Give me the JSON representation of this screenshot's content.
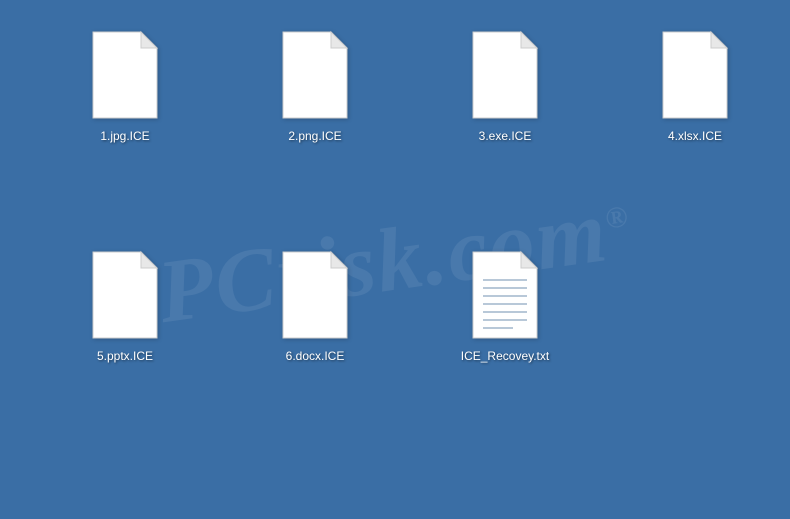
{
  "files": [
    {
      "label": "1.jpg.ICE",
      "icon": "blank"
    },
    {
      "label": "2.png.ICE",
      "icon": "blank"
    },
    {
      "label": "3.exe.ICE",
      "icon": "blank"
    },
    {
      "label": "4.xlsx.ICE",
      "icon": "blank"
    },
    {
      "label": "5.pptx.ICE",
      "icon": "blank"
    },
    {
      "label": "6.docx.ICE",
      "icon": "blank"
    },
    {
      "label": "ICE_Recovey.txt",
      "icon": "text"
    }
  ],
  "watermark": "PCrisk.com"
}
